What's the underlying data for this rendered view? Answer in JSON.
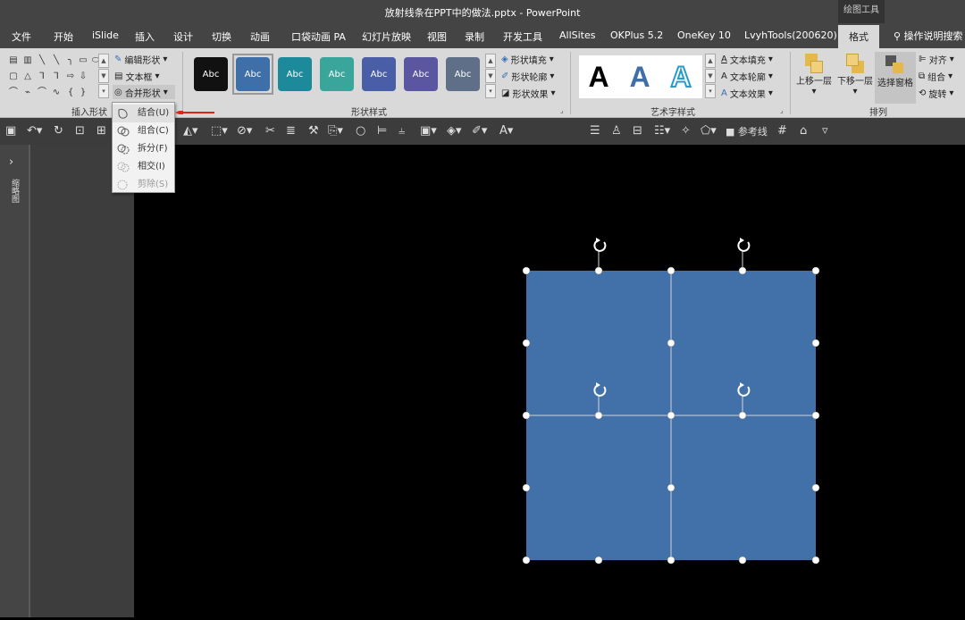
{
  "window": {
    "title": "放射线条在PPT中的做法.pptx  -  PowerPoint",
    "context_tool": "绘图工具"
  },
  "tabs": [
    "文件",
    "开始",
    "iSlide",
    "插入",
    "设计",
    "切换",
    "动画",
    "口袋动画 PA",
    "幻灯片放映",
    "视图",
    "录制",
    "开发工具",
    "AllSites",
    "OKPlus 5.2",
    "OneKey 10",
    "LvyhTools(200620)",
    "格式"
  ],
  "active_tab": "格式",
  "tell_me": "操作说明搜索",
  "ribbon": {
    "insert_shapes": {
      "label": "插入形状",
      "edit_shape": "编辑形状",
      "text_box": "文本框",
      "merge_shapes": "合并形状"
    },
    "shape_styles": {
      "label": "形状样式",
      "swatches": [
        {
          "text": "Abc",
          "color": "#111111"
        },
        {
          "text": "Abc",
          "color": "#3e6fa8"
        },
        {
          "text": "Abc",
          "color": "#1d8a9b"
        },
        {
          "text": "Abc",
          "color": "#3aa59b"
        },
        {
          "text": "Abc",
          "color": "#4a5ea8"
        },
        {
          "text": "Abc",
          "color": "#5a56a0"
        },
        {
          "text": "Abc",
          "color": "#5f6f87"
        }
      ],
      "fill": "形状填充",
      "outline": "形状轮廓",
      "effects": "形状效果"
    },
    "wordart": {
      "label": "艺术字样式",
      "samples": [
        "A",
        "A",
        "A"
      ],
      "text_fill": "文本填充",
      "text_outline": "文本轮廓",
      "text_effects": "文本效果"
    },
    "arrange": {
      "label": "排列",
      "bring_forward": "上移一层",
      "send_backward": "下移一层",
      "selection_pane": "选择窗格",
      "align": "对齐",
      "group": "组合",
      "rotate": "旋转"
    }
  },
  "qat": {
    "font": "思源黑体",
    "guides": "参考线"
  },
  "merge_menu": {
    "items": [
      {
        "label": "结合(U)",
        "enabled": true
      },
      {
        "label": "组合(C)",
        "enabled": true
      },
      {
        "label": "拆分(F)",
        "enabled": true
      },
      {
        "label": "相交(I)",
        "enabled": true
      },
      {
        "label": "剪除(S)",
        "enabled": false
      }
    ]
  },
  "left_pane": {
    "collapsed_label": "缩略图"
  },
  "colors": {
    "shape_fill": "#4270a8",
    "accent_red": "#e0241c",
    "ribbon_bg": "#d9d9d9",
    "titlebar": "#444444"
  }
}
